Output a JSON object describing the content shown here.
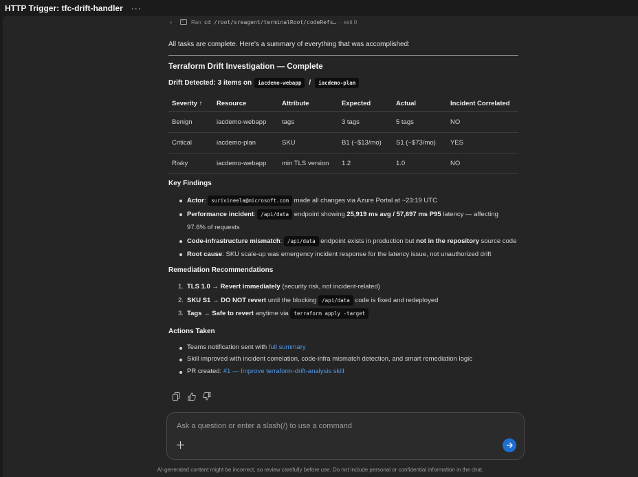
{
  "title": "HTTP Trigger: tfc-drift-handler",
  "title_menu": "···",
  "ran": {
    "prefix": "Ran",
    "command": "cd /root/sreagent/terminalRoot/codeRefs…",
    "sep": "·",
    "exit": "exit 0"
  },
  "intro": "All tasks are complete. Here's a summary of everything that was accomplished:",
  "heading": "Terraform Drift Investigation — Complete",
  "drift": {
    "label": "Drift Detected: 3 items on",
    "code1": "iacdemo-webapp",
    "slash": "/",
    "code2": "iacdemo-plan"
  },
  "table": {
    "headers": [
      "Severity ↑",
      "Resource",
      "Attribute",
      "Expected",
      "Actual",
      "Incident Correlated"
    ],
    "rows": [
      [
        "Benign",
        "iacdemo-webapp",
        "tags",
        "3 tags",
        "5 tags",
        "NO"
      ],
      [
        "Critical",
        "iacdemo-plan",
        "SKU",
        "B1 (~$13/mo)",
        "S1 (~$73/mo)",
        "YES"
      ],
      [
        "Risky",
        "iacdemo-webapp",
        "min TLS version",
        "1.2",
        "1.0",
        "NO"
      ]
    ]
  },
  "key_findings": {
    "heading": "Key Findings",
    "actor_label": "Actor",
    "actor_sep": ":",
    "actor_code": "surivineela@microsoft.com",
    "actor_text": "made all changes via Azure Portal at ~23:19 UTC",
    "perf_label": "Performance incident",
    "perf_sep": ":",
    "perf_code": "/api/data",
    "perf_text1": "endpoint showing",
    "perf_bold": "25,919 ms avg / 57,697 ms P95",
    "perf_text2": "latency — affecting 97.6% of requests",
    "mismatch_label": "Code-infrastructure mismatch",
    "mismatch_sep": ":",
    "mismatch_code": "/api/data",
    "mismatch_text1": "endpoint exists in production but",
    "mismatch_bold": "not in the repository",
    "mismatch_text2": "source code",
    "root_label": "Root cause",
    "root_text": ": SKU scale-up was emergency incident response for the latency issue, not unauthorized drift"
  },
  "remediation": {
    "heading": "Remediation Recommendations",
    "items": [
      {
        "num": "1.",
        "bold": "TLS 1.0 → Revert immediately",
        "text": "(security risk, not incident-related)"
      },
      {
        "num": "2.",
        "bold": "SKU S1 → DO NOT revert",
        "text": "until the blocking",
        "code": "/api/data",
        "text2": "code is fixed and redeployed"
      },
      {
        "num": "3.",
        "bold": "Tags → Safe to revert",
        "text": "anytime via",
        "code": "terraform apply -target"
      }
    ]
  },
  "actions": {
    "heading": "Actions Taken",
    "teams_text": "Teams notification sent with",
    "teams_link": "full summary",
    "skill_text": "Skill improved with incident correlation, code-infra mismatch detection, and smart remediation logic",
    "pr_text": "PR created:",
    "pr_link": "#1 — Improve terraform-drift-analysis skill"
  },
  "icons": [
    "copy-icon",
    "thumbs-up-icon",
    "thumbs-down-icon",
    "plus-icon",
    "send-icon",
    "terminal-icon",
    "chevron-right-icon"
  ],
  "input": {
    "placeholder": "Ask a question or enter a slash(/) to use a command"
  },
  "disclaimer": "AI-generated content might be incorrect, so review carefully before use. Do not include personal or confidential information in the chat.",
  "colors": {
    "background": "#252526",
    "link": "#4f9ae8",
    "send_button": "#1f6fd1"
  }
}
